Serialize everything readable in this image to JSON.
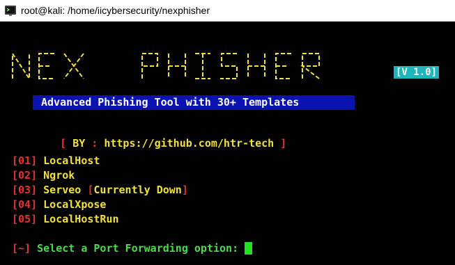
{
  "window": {
    "title": "root@kali: /home/iicybersecurity/nexphisher"
  },
  "logo": {
    "ascii_lines": [
      " ___  __  ___  __   __      __   ___  ___  __  ___  __  ___  __   __",
      "|   \\|   \\ _/   |__)|__||   /__` |__| |__ |__)",
      "|  \\ |__  / \\   |   |  ||  .__/ |  | |___|  \\"
    ],
    "text": "NEX PHISHER",
    "version": "[V 1.0]"
  },
  "banner": {
    "text": "Advanced Phishing Tool with 30+ Templates"
  },
  "credit": {
    "open": "[",
    "by": "BY",
    "sep": ":",
    "url": "https://github.com/htr-tech",
    "close": "]"
  },
  "menu": {
    "items": [
      {
        "num": "[01]",
        "label": "LocalHost",
        "note": ""
      },
      {
        "num": "[02]",
        "label": "Ngrok",
        "note": ""
      },
      {
        "num": "[03]",
        "label": "Serveo",
        "note": "[Currently Down]"
      },
      {
        "num": "[04]",
        "label": "LocalXpose",
        "note": ""
      },
      {
        "num": "[05]",
        "label": "LocalHostRun",
        "note": ""
      }
    ]
  },
  "prompt": {
    "marker": "[~]",
    "text": "Select a Port Forwarding option:"
  },
  "colors": {
    "yellow": "#f1e233",
    "red": "#e5322d",
    "green": "#4bdc4b",
    "cyan": "#1fb5bb",
    "banner_bg": "#0a12b0"
  }
}
